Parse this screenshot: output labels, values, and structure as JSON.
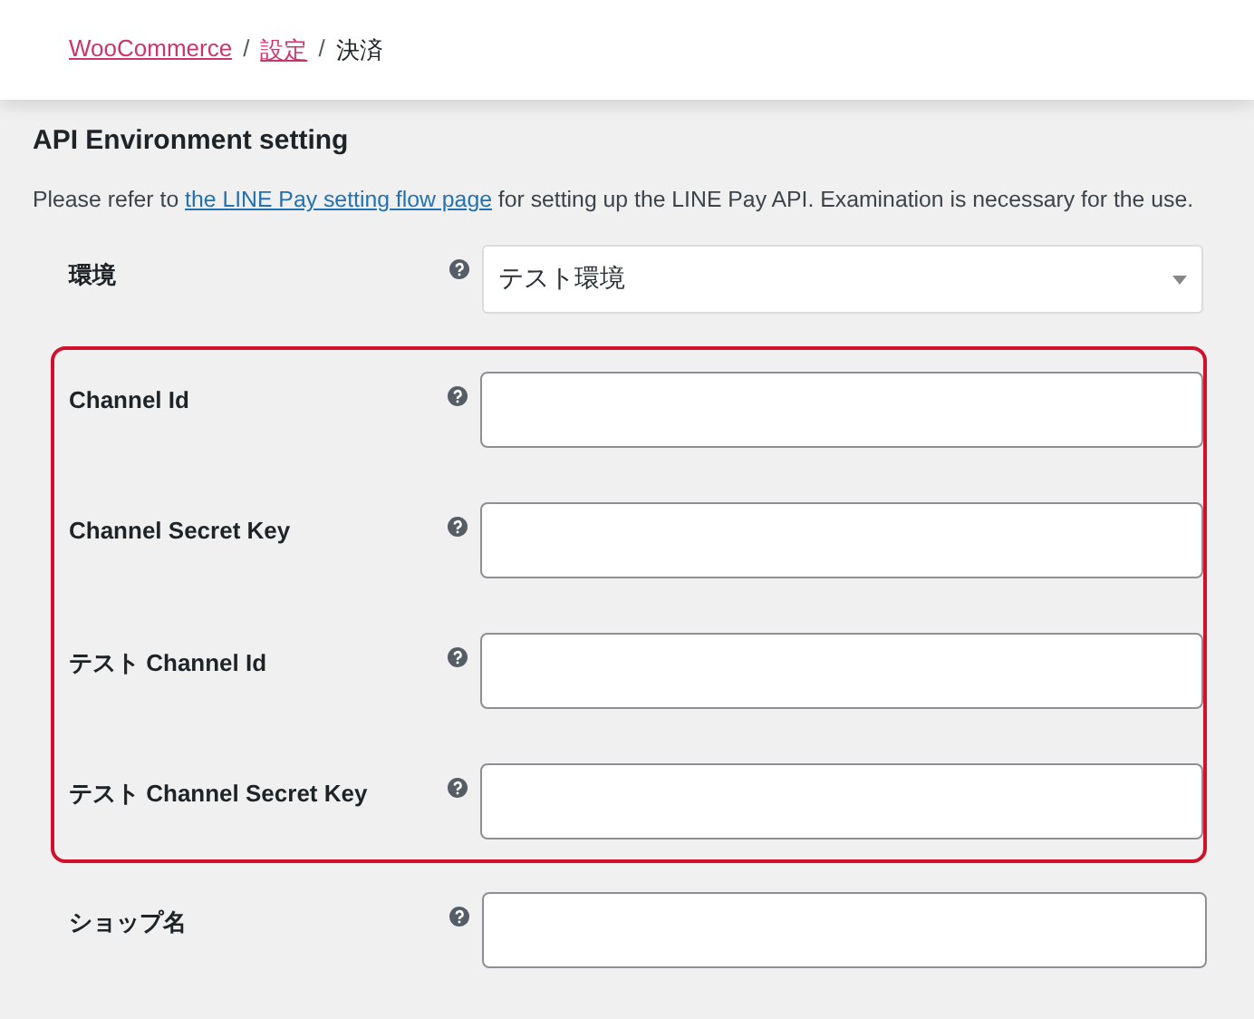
{
  "breadcrumb": [
    {
      "label": "WooCommerce",
      "link": true
    },
    {
      "label": "設定",
      "link": true
    },
    {
      "label": "決済",
      "link": false
    }
  ],
  "breadcrumb_separator": "/",
  "section_title": "API Environment setting",
  "description": {
    "before": "Please refer to ",
    "link": "the LINE Pay setting flow page",
    "after": " for setting up the LINE Pay API. Examination is necessary for the use."
  },
  "fields": [
    {
      "label": "環境",
      "kind": "select",
      "value": "テスト環境",
      "highlighted": false
    },
    {
      "label": "Channel Id",
      "kind": "text",
      "highlighted": true
    },
    {
      "label": "Channel Secret Key",
      "kind": "text",
      "highlighted": true
    },
    {
      "label": "テスト Channel Id",
      "kind": "text",
      "highlighted": true
    },
    {
      "label": "テスト Channel Secret Key",
      "kind": "text",
      "highlighted": true
    },
    {
      "label": "ショップ名",
      "kind": "text",
      "highlighted": false
    }
  ]
}
